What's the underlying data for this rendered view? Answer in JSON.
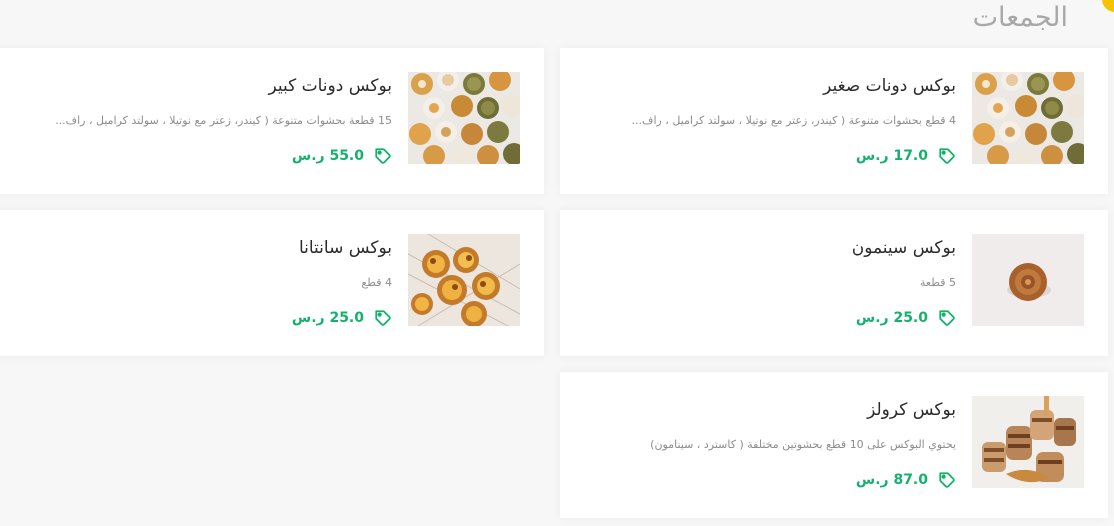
{
  "section": {
    "title": "الجمعات"
  },
  "colors": {
    "accent": "#13b26b",
    "badge": "#f4c400",
    "title": "#a8a8a8"
  },
  "products": [
    {
      "name": "بوكس دونات صغير",
      "desc": "4 قطع بحشوات متنوعة ( كيندر، زعتر مع نوتيلا ، سولتد كراميل ، راف...",
      "price": "17.0 ر.س",
      "icon": "price-tag-icon",
      "image": "mini-donuts-photo"
    },
    {
      "name": "بوكس دونات كبير",
      "desc": "15 قطعة بحشوات متنوعة ( كيندر، زعتر مع نوتيلا ، سولتد كراميل ، راف...",
      "price": "55.0 ر.س",
      "icon": "price-tag-icon",
      "image": "mini-donuts-photo"
    },
    {
      "name": "بوكس سينمون",
      "desc": "5 قطعة",
      "price": "25.0 ر.س",
      "icon": "price-tag-icon",
      "image": "cinnamon-roll-photo"
    },
    {
      "name": "بوكس سانتانا",
      "desc": "4 قطع",
      "price": "25.0 ر.س",
      "icon": "price-tag-icon",
      "image": "custard-tarts-photo"
    },
    {
      "name": "بوكس كرولز",
      "desc": "يحتوي البوكس على 10 قطع بحشوتين مختلفة ( كاسترد ، سينامون)",
      "price": "87.0 ر.س",
      "icon": "price-tag-icon",
      "image": "cruffins-photo"
    }
  ]
}
